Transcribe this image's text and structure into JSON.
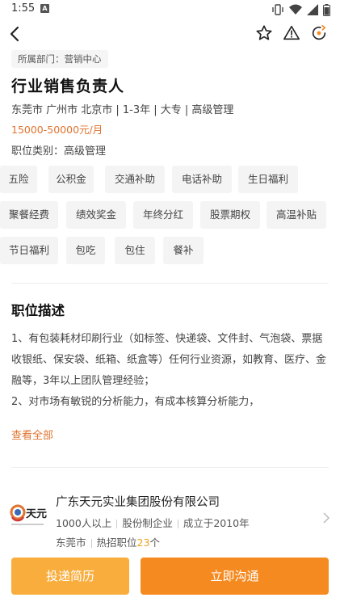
{
  "status_bar": {
    "time": "1:55",
    "notification_badge": "A"
  },
  "header": {
    "icons": [
      "back-icon",
      "star-icon",
      "warning-icon",
      "share-refresh-icon"
    ]
  },
  "job": {
    "department": "所属部门：营销中心",
    "title": "行业销售负责人",
    "meta": "东莞市 广州市 北京市 | 1-3年 | 大专 | 高级管理",
    "salary": "15000-50000元/月",
    "category": "职位类别：高级管理"
  },
  "benefits": [
    "五险",
    "公积金",
    "交通补助",
    "电话补助",
    "生日福利",
    "聚餐经费",
    "绩效奖金",
    "年终分红",
    "股票期权",
    "高温补贴",
    "节日福利",
    "包吃",
    "包住",
    "餐补"
  ],
  "description": {
    "title": "职位描述",
    "lines": [
      "1、有包装耗材印刷行业（如标签、快递袋、文件封、气泡袋、票据收银纸、保安袋、纸箱、纸盒等）任何行业资源，如教育、医疗、金融等，3年以上团队管理经验；",
      "2、对市场有敏锐的分析能力，有成本核算分析能力，"
    ],
    "see_all": "查看全部"
  },
  "company": {
    "logo_text": "天元",
    "name": "广东天元实业集团股份有限公司",
    "size": "1000人以上",
    "type": "股份制企业",
    "founded": "成立于2010年",
    "city": "东莞市",
    "hot_label": "热招职位",
    "hot_count": "23",
    "hot_suffix": "个"
  },
  "actions": {
    "resume": "投递简历",
    "chat": "立即沟通"
  },
  "colors": {
    "accent_orange": "#f58a20",
    "light_orange": "#f8ad3c",
    "salary_orange": "#e0742f",
    "count_orange": "#f0a020"
  }
}
